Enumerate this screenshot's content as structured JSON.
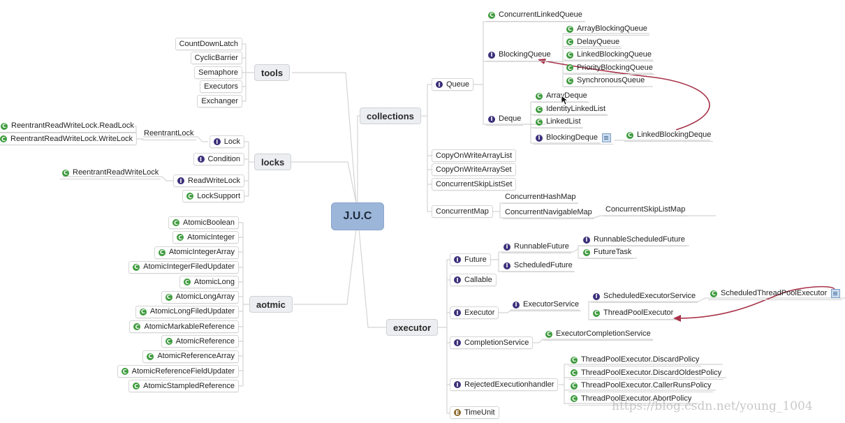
{
  "root": {
    "label": "J.U.C"
  },
  "branches": {
    "tools": {
      "label": "tools",
      "items": [
        "CountDownLatch",
        "CyclicBarrier",
        "Semaphore",
        "Executors",
        "Exchanger"
      ]
    },
    "locks": {
      "label": "locks",
      "lock": {
        "label": "Lock",
        "icon": "interface-icon",
        "child": {
          "label": "ReentrantLock",
          "children": [
            {
              "label": "ReentrantReadWriteLock.ReadLock",
              "icon": "class-icon"
            },
            {
              "label": "ReentrantReadWriteLock.WriteLock",
              "icon": "class-icon"
            }
          ]
        }
      },
      "condition": {
        "label": "Condition",
        "icon": "interface-icon"
      },
      "readwritelock": {
        "label": "ReadWriteLock",
        "icon": "interface-icon",
        "child": {
          "label": "ReentrantReadWriteLock",
          "icon": "class-icon"
        }
      },
      "locksupport": {
        "label": "LockSupport",
        "icon": "class-icon"
      }
    },
    "aotmic": {
      "label": "aotmic",
      "items": [
        "AtomicBoolean",
        "AtomicInteger",
        "AtomicIntegerArray",
        "AtomicIntegerFiledUpdater",
        "AtomicLong",
        "AtomicLongArray",
        "AtomicLongFiledUpdater",
        "AtomicMarkableReference",
        "AtomicReference",
        "AtomicReferenceArray",
        "AtomicReferenceFieldUpdater",
        "AtomicStampledReference"
      ]
    },
    "collections": {
      "label": "collections",
      "queue": {
        "label": "Queue",
        "icon": "interface-icon",
        "concurrentlinkedqueue": {
          "label": "ConcurrentLinkedQueue",
          "icon": "class-icon"
        },
        "blockingqueue": {
          "label": "BlockingQueue",
          "icon": "interface-icon",
          "children": [
            "ArrayBlockingQueue",
            "DelayQueue",
            "LinkedBlockingQueue",
            "PriorityBlockingQueue",
            "SynchronousQueue"
          ]
        },
        "deque": {
          "label": "Deque",
          "icon": "interface-icon",
          "children": [
            {
              "label": "ArrayDeque",
              "icon": "class-icon"
            },
            {
              "label": "IdentityLinkedList",
              "icon": "class-icon"
            },
            {
              "label": "LinkedList",
              "icon": "class-icon"
            },
            {
              "label": "BlockingDeque",
              "icon": "interface-icon"
            }
          ],
          "blockingdeque_child": {
            "label": "LinkedBlockingDeque",
            "icon": "class-icon"
          }
        }
      },
      "others": [
        "CopyOnWriteArrayList",
        "CopyOnWriteArraySet",
        "ConcurrentSkipListSet"
      ],
      "concurrentmap": {
        "label": "ConcurrentMap",
        "children": [
          "ConcurrentHashMap",
          "ConcurrentNavigableMap"
        ],
        "navigable_child": "ConcurrentSkipListMap"
      }
    },
    "executor": {
      "label": "executor",
      "future": {
        "label": "Future",
        "icon": "interface-icon",
        "runnablefuture": {
          "label": "RunnableFuture",
          "icon": "interface-icon",
          "children": [
            {
              "label": "RunnableScheduledFuture",
              "icon": "interface-icon"
            },
            {
              "label": "FutureTask",
              "icon": "class-icon"
            }
          ]
        },
        "scheduledfuture": {
          "label": "ScheduledFuture",
          "icon": "interface-icon"
        }
      },
      "callable": {
        "label": "Callable",
        "icon": "interface-icon"
      },
      "executor": {
        "label": "Executor",
        "icon": "interface-icon",
        "executorservice": {
          "label": "ExecutorService",
          "icon": "interface-icon",
          "scheduledexecutorservice": {
            "label": "ScheduledExecutorService",
            "icon": "interface-icon",
            "child": {
              "label": "ScheduledThreadPoolExecutor",
              "icon": "class-icon"
            }
          },
          "threadpoolexecutor": {
            "label": "ThreadPoolExecutor",
            "icon": "class-icon"
          }
        }
      },
      "completionservice": {
        "label": "CompletionService",
        "icon": "interface-icon",
        "child": {
          "label": "ExecutorCompletionService",
          "icon": "class-icon"
        }
      },
      "rejected": {
        "label": "RejectedExecutionhandler",
        "icon": "interface-icon",
        "children": [
          "ThreadPoolExecutor.DiscardPolicy",
          "ThreadPoolExecutor.DiscardOldestPolicy",
          "ThreadPoolExecutor.CallerRunsPolicy",
          "ThreadPoolExecutor.AbortPolicy"
        ]
      },
      "timeunit": {
        "label": "TimeUnit",
        "icon": "enum-icon"
      }
    }
  },
  "icons": {
    "class": "C",
    "interface": "I",
    "enum": "E"
  },
  "colors": {
    "root_fill": "#9cb6da",
    "class_icon": "#3c9a3c",
    "interface_icon": "#3b2f7a",
    "enum_icon": "#8a6a2a",
    "arrow": "#a8334a",
    "connector": "#d2d2d2"
  },
  "watermark": "https://blog.csdn.net/young_1004"
}
